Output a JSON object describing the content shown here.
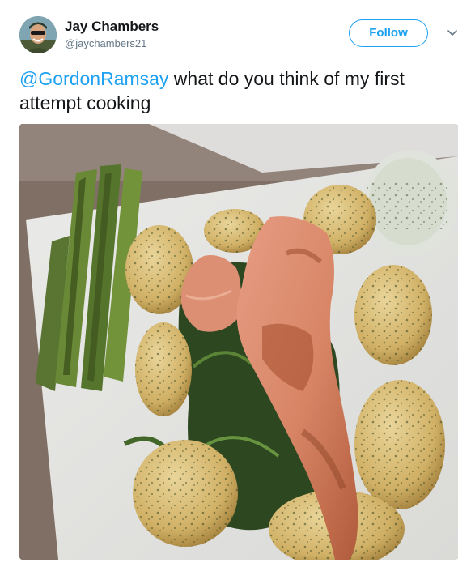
{
  "author": {
    "display_name": "Jay Chambers",
    "handle": "@jaychambers21"
  },
  "follow_button": {
    "label": "Follow"
  },
  "tweet": {
    "mention": "@GordonRamsay",
    "text": " what do you think of my first attempt cooking"
  },
  "icons": {
    "menu": "chevron-down-icon",
    "avatar": "user-avatar"
  },
  "colors": {
    "accent": "#1da1f2",
    "text": "#14171a",
    "secondary": "#657786"
  }
}
